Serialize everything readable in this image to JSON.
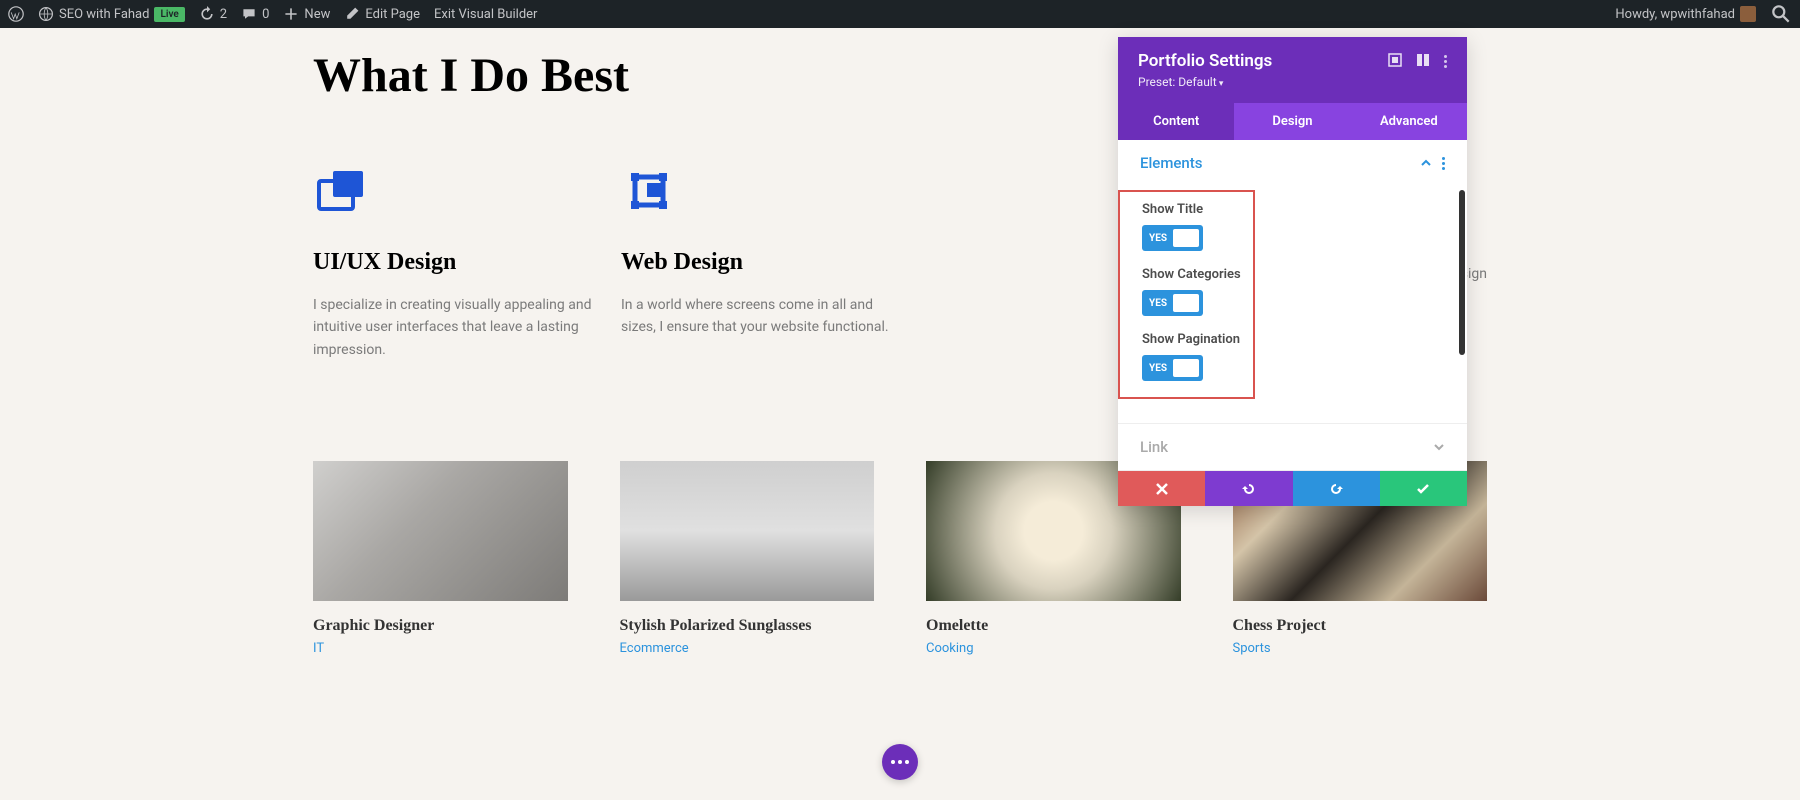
{
  "admin_bar": {
    "site_name": "SEO with Fahad",
    "live_label": "Live",
    "refresh_count": "2",
    "comments_count": "0",
    "new_label": "New",
    "edit_page_label": "Edit Page",
    "exit_vb_label": "Exit Visual Builder",
    "howdy": "Howdy, wpwithfahad"
  },
  "page": {
    "heading": "What I Do Best",
    "services": [
      {
        "title": "UI/UX Design",
        "desc": "I specialize in creating visually appealing and intuitive user interfaces that leave a lasting impression."
      },
      {
        "title": "Web Design",
        "desc": "In a world where screens come in all and sizes, I ensure that your website functional."
      },
      {
        "title": "",
        "desc": "help sign"
      }
    ],
    "portfolio": [
      {
        "title": "Graphic Designer",
        "category": "IT"
      },
      {
        "title": "Stylish Polarized Sunglasses",
        "category": "Ecommerce"
      },
      {
        "title": "Omelette",
        "category": "Cooking"
      },
      {
        "title": "Chess Project",
        "category": "Sports"
      }
    ]
  },
  "panel": {
    "title": "Portfolio Settings",
    "preset": "Preset: Default",
    "tabs": {
      "content": "Content",
      "design": "Design",
      "advanced": "Advanced"
    },
    "sections": {
      "elements": {
        "title": "Elements",
        "show_title_label": "Show Title",
        "show_categories_label": "Show Categories",
        "show_pagination_label": "Show Pagination",
        "toggle_yes": "YES"
      },
      "link": {
        "title": "Link"
      }
    }
  }
}
